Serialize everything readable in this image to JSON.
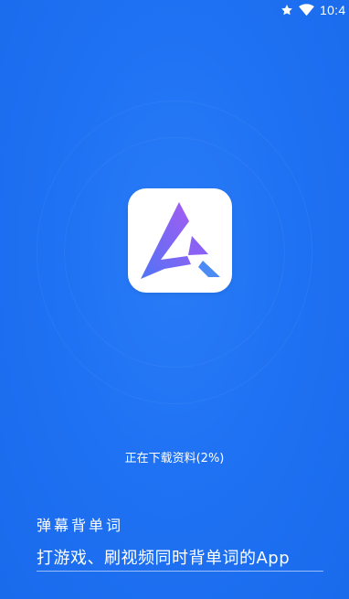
{
  "status_bar": {
    "time": "10:4",
    "icons": [
      "star-icon",
      "wifi-icon"
    ]
  },
  "colors": {
    "background": "#1E6FF2",
    "logo_tile": "#FFFFFF",
    "logo_gradient_start": "#5A68F5",
    "logo_gradient_end": "#A35BF2",
    "logo_accent": "#4C8BF6"
  },
  "logo": {
    "icon": "app-logo-icon"
  },
  "loading": {
    "text": "正在下载资料(2%)",
    "progress_percent": 2
  },
  "brand": {
    "title": "弹幕背单词",
    "slogan": "打游戏、刷视频同时背单词的App"
  }
}
